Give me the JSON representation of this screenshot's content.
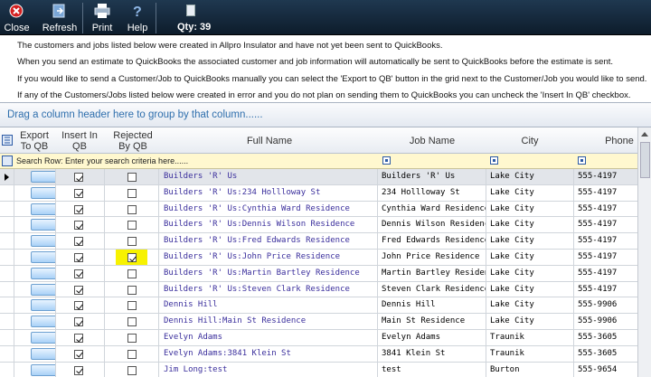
{
  "toolbar": {
    "close_label": "Close",
    "refresh_label": "Refresh",
    "print_label": "Print",
    "help_label": "Help",
    "qty_label": "Qty: 39"
  },
  "info_lines": [
    "The customers and jobs listed below were created in Allpro Insulator and have not yet been sent to QuickBooks.",
    "When you send an estimate to QuickBooks the associated customer and job information will automatically be sent to QuickBooks before the estimate is sent.",
    "If you would like to send a Customer/Job to QuickBooks manually you can select the 'Export to QB' button in the grid next to the Customer/Job you would like to send.",
    "If any of the Customers/Jobs listed below were created in error and you do not plan on sending them to QuickBooks you can uncheck the 'Insert In QB' checkbox."
  ],
  "group_bar_text": "Drag a column header here to group by that column......",
  "columns": {
    "export": "Export To QB",
    "insert": "Insert In QB",
    "rejected": "Rejected By QB",
    "full_name": "Full Name",
    "job_name": "Job Name",
    "city": "City",
    "phone": "Phone"
  },
  "search_text": "Search Row: Enter your search criteria here......",
  "rows": [
    {
      "full_name": "Builders 'R' Us",
      "job_name": "Builders 'R' Us",
      "city": "Lake City",
      "phone": "555-4197",
      "insert": true,
      "rejected": false
    },
    {
      "full_name": "Builders 'R' Us:234 Hollloway St",
      "job_name": "234 Hollloway St",
      "city": "Lake City",
      "phone": "555-4197",
      "insert": true,
      "rejected": false
    },
    {
      "full_name": "Builders 'R' Us:Cynthia Ward Residence",
      "job_name": "Cynthia Ward Residence",
      "city": "Lake City",
      "phone": "555-4197",
      "insert": true,
      "rejected": false
    },
    {
      "full_name": "Builders 'R' Us:Dennis Wilson Residence",
      "job_name": "Dennis Wilson Residence",
      "city": "Lake City",
      "phone": "555-4197",
      "insert": true,
      "rejected": false
    },
    {
      "full_name": "Builders 'R' Us:Fred Edwards Residence",
      "job_name": "Fred Edwards Residence",
      "city": "Lake City",
      "phone": "555-4197",
      "insert": true,
      "rejected": false
    },
    {
      "full_name": "Builders 'R' Us:John Price Residence",
      "job_name": "John Price Residence",
      "city": "Lake City",
      "phone": "555-4197",
      "insert": true,
      "rejected": true
    },
    {
      "full_name": "Builders 'R' Us:Martin Bartley Residence",
      "job_name": "Martin Bartley Residence",
      "city": "Lake City",
      "phone": "555-4197",
      "insert": true,
      "rejected": false
    },
    {
      "full_name": "Builders 'R' Us:Steven Clark Residence",
      "job_name": "Steven Clark Residence",
      "city": "Lake City",
      "phone": "555-4197",
      "insert": true,
      "rejected": false
    },
    {
      "full_name": "Dennis Hill",
      "job_name": "Dennis Hill",
      "city": "Lake City",
      "phone": "555-9906",
      "insert": true,
      "rejected": false
    },
    {
      "full_name": "Dennis Hill:Main St Residence",
      "job_name": "Main St Residence",
      "city": "Lake City",
      "phone": "555-9906",
      "insert": true,
      "rejected": false
    },
    {
      "full_name": "Evelyn Adams",
      "job_name": "Evelyn Adams",
      "city": "Traunik",
      "phone": "555-3605",
      "insert": true,
      "rejected": false
    },
    {
      "full_name": "Evelyn Adams:3841 Klein St",
      "job_name": "3841 Klein St",
      "city": "Traunik",
      "phone": "555-3605",
      "insert": true,
      "rejected": false
    },
    {
      "full_name": "Jim Long:test",
      "job_name": "test",
      "city": "Burton",
      "phone": "555-9654",
      "insert": true,
      "rejected": false
    }
  ],
  "colors": {
    "toolbar": "#1a3047",
    "group_text": "#2f6fad",
    "name_link": "#3a2e9c",
    "search_row": "#fff8cf",
    "highlight": "#f7f200"
  }
}
